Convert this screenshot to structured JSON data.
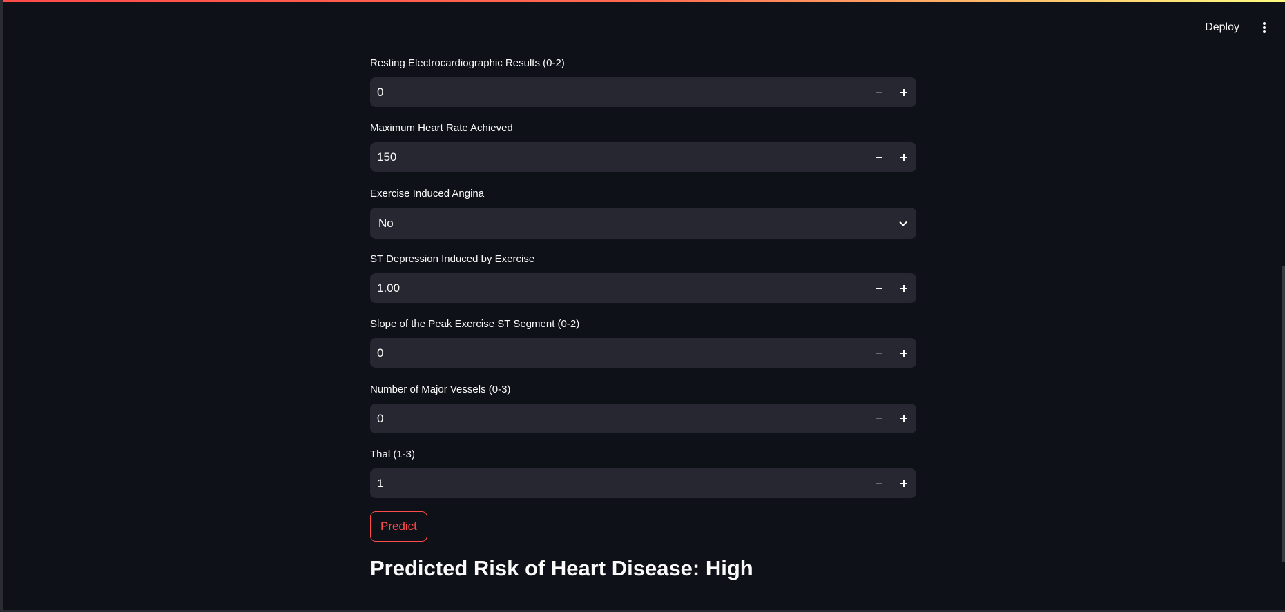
{
  "header": {
    "deploy_label": "Deploy",
    "menu_icon": "kebab-menu-icon"
  },
  "form": {
    "fields": [
      {
        "label": "Resting Electrocardiographic Results (0-2)",
        "value": "0",
        "decrement_enabled": false
      },
      {
        "label": "Maximum Heart Rate Achieved",
        "value": "150",
        "decrement_enabled": true
      },
      {
        "label": "Exercise Induced Angina",
        "value": "No",
        "type": "select"
      },
      {
        "label": "ST Depression Induced by Exercise",
        "value": "1.00",
        "decrement_enabled": true
      },
      {
        "label": "Slope of the Peak Exercise ST Segment (0-2)",
        "value": "0",
        "decrement_enabled": false
      },
      {
        "label": "Number of Major Vessels (0-3)",
        "value": "0",
        "decrement_enabled": false
      },
      {
        "label": "Thal (1-3)",
        "value": "1",
        "decrement_enabled": false
      }
    ],
    "predict_label": "Predict"
  },
  "result": {
    "heading": "Predicted Risk of Heart Disease: High"
  },
  "colors": {
    "background": "#0e1117",
    "input_bg": "#262730",
    "accent": "#ff4b4b",
    "text": "#fafafa",
    "disabled_icon": "#6b6c73"
  }
}
